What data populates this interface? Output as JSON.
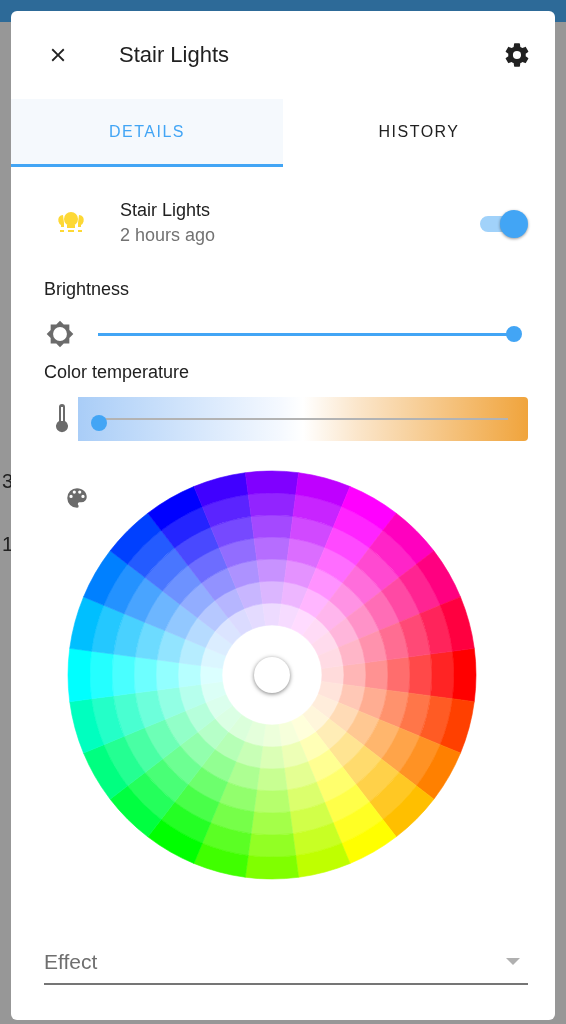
{
  "backdrop": {
    "texts": [
      "3",
      "1"
    ]
  },
  "header": {
    "title": "Stair Lights"
  },
  "tabs": [
    {
      "label": "DETAILS",
      "selected": true
    },
    {
      "label": "HISTORY",
      "selected": false
    }
  ],
  "entity": {
    "name": "Stair Lights",
    "last_changed": "2 hours ago",
    "on": true
  },
  "brightness": {
    "label": "Brightness",
    "level": 1.0
  },
  "color_temperature": {
    "label": "Color temperature",
    "level": 0.0
  },
  "effect": {
    "placeholder": "Effect"
  }
}
